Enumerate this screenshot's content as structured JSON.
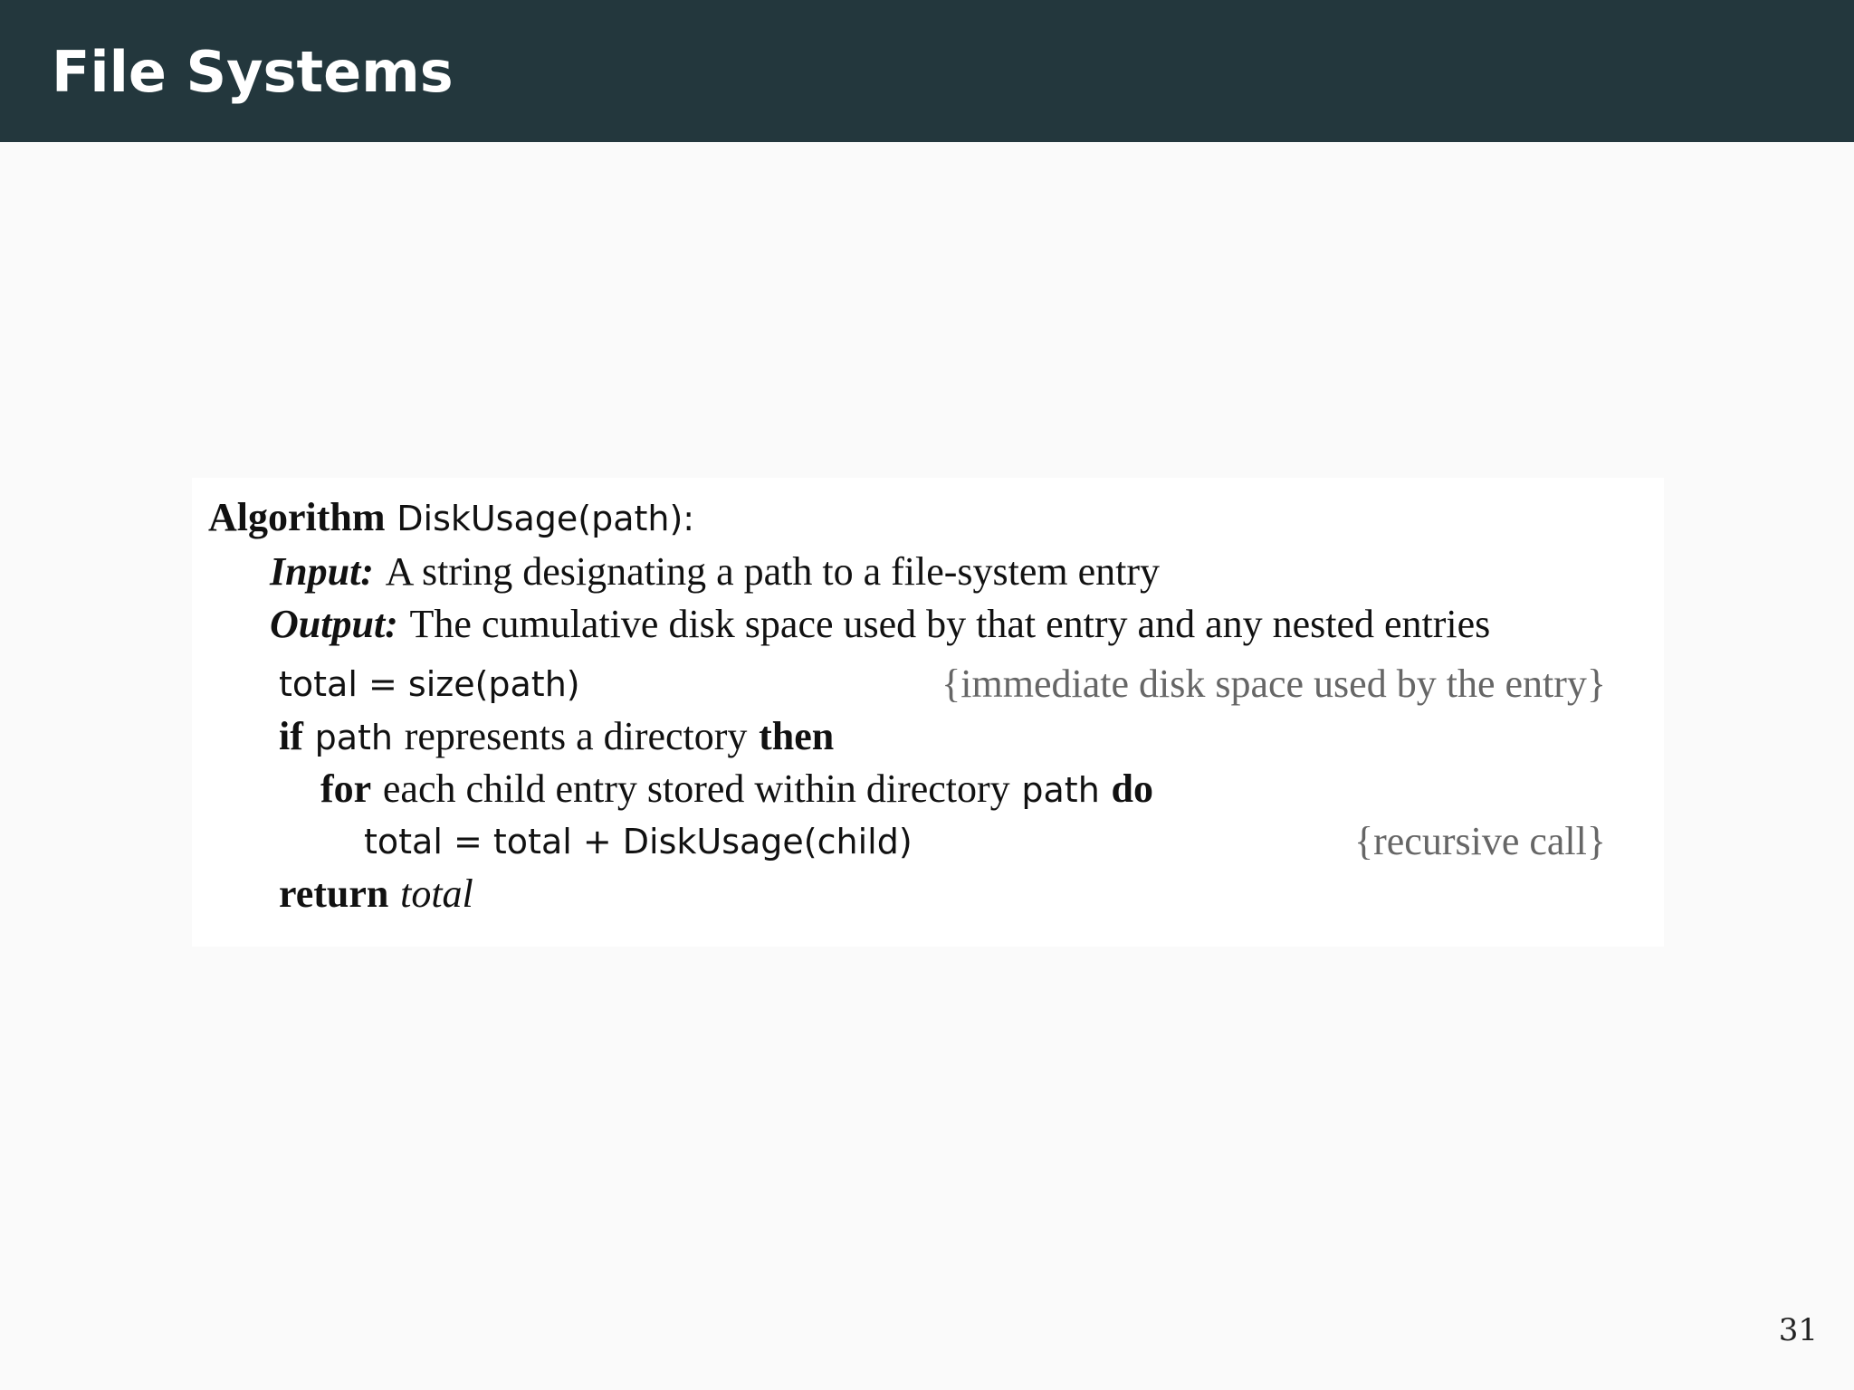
{
  "slide": {
    "title": "File Systems",
    "page_number": "31"
  },
  "algorithm": {
    "keyword_algorithm": "Algorithm",
    "signature": "DiskUsage(path):",
    "input_label": "Input:",
    "input_text": "A string designating a path to a file-system entry",
    "output_label": "Output:",
    "output_text": "The cumulative disk space used by that entry and any nested entries",
    "line1_code": "total = size(path)",
    "line1_comment": "{immediate disk space used by the entry}",
    "line2_if": "if",
    "line2_path": "path",
    "line2_text": "represents a directory",
    "line2_then": "then",
    "line3_for": "for",
    "line3_text": "each child entry stored within directory",
    "line3_path": "path",
    "line3_do": "do",
    "line4_code": "total = total + DiskUsage(child)",
    "line4_comment": "{recursive call}",
    "line5_return": "return",
    "line5_value": "total"
  }
}
